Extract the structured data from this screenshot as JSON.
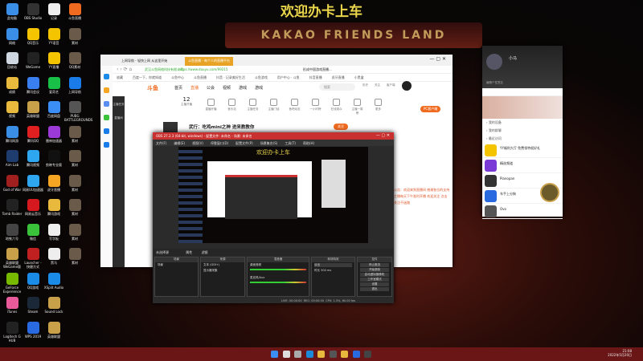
{
  "overlay_title": "欢迎办卡上车",
  "sign_text": "KAKAO FRIENDS LAND",
  "desktop": {
    "icons": [
      [
        "此电脑",
        "#3a8ee6"
      ],
      [
        "网络",
        "#3a8ee6"
      ],
      [
        "回收站",
        "#cfd8e0"
      ],
      [
        "成绩",
        "#e8b93c"
      ],
      [
        "视频",
        "#e8b93c"
      ],
      [
        "腾讯网游",
        "#3a8ee6"
      ],
      [
        "Aim Lab",
        "#1e3c6e"
      ],
      [
        "God of War",
        "#a02020"
      ],
      [
        "Tomb Raider",
        "#222"
      ],
      [
        "地铁六号",
        "#444"
      ],
      [
        "英雄联盟WeGame版",
        "#c9a04a"
      ],
      [
        "GeForce Experience",
        "#76b900"
      ],
      [
        "iTunes",
        "#e85a9a"
      ],
      [
        "Logitech G HUB",
        "#222"
      ],
      [
        "OBS Studio",
        "#333"
      ],
      [
        "QQ音乐",
        "#f5c400"
      ],
      [
        "WeGame",
        "#222"
      ],
      [
        "腾讯会议",
        "#3a7ff0"
      ],
      [
        "英雄联盟",
        "#c9a04a"
      ],
      [
        "腾讯QQ",
        "#e02020"
      ],
      [
        "腾讯视频",
        "#2fa6f0"
      ],
      [
        "网易UU加速器",
        "#2fa6f0"
      ],
      [
        "网易云音乐",
        "#d6191e"
      ],
      [
        "微信",
        "#3ac33a"
      ],
      [
        "Launcher - 快捷方式",
        "#c02020"
      ],
      [
        "QQ游戏",
        "#1a8ce8"
      ],
      [
        "Steam",
        "#1b2838"
      ],
      [
        "WPS 2019",
        "#2a6ae0"
      ],
      [
        "记录",
        "#eee"
      ],
      [
        "YY语音",
        "#f5c400"
      ],
      [
        "YY直播",
        "#f5c400"
      ],
      [
        "爱奇艺",
        "#18c047"
      ],
      [
        "百度网盘",
        "#3a8ef6"
      ],
      [
        "雷神加速器",
        "#9b3ad6"
      ],
      [
        "剪映专业版",
        "#111"
      ],
      [
        "虎牙直播",
        "#f5a623"
      ],
      [
        "腾讯游戏",
        "#e8b93c"
      ],
      [
        "写字板",
        "#eee"
      ],
      [
        "黑马",
        "#eee"
      ],
      [
        "XSplit Audio",
        "#1a8ce8"
      ],
      [
        "Sound Lock",
        "#c9a04a"
      ],
      [
        "英雄联盟",
        "#c9a04a"
      ],
      [
        "斗鱼直播",
        "#f06a20"
      ],
      [
        "素材",
        "#6a5a4a"
      ],
      [
        "QQ素材",
        "#6a5a4a"
      ],
      [
        "上网导航",
        "#1a7ce8"
      ],
      [
        "PUBG BATTLEGROUNDS",
        "#555"
      ],
      [
        "素材",
        "#6a5a4a"
      ],
      [
        "素材",
        "#6a5a4a"
      ],
      [
        "素材",
        "#6a5a4a"
      ],
      [
        "素材",
        "#6a5a4a"
      ],
      [
        "素材",
        "#6a5a4a"
      ],
      [
        "素材",
        "#6a5a4a"
      ]
    ]
  },
  "browser": {
    "tabs": [
      "上网导航 - 轻快上网 从这里开始",
      "斗鱼直播 - 每个人的直播平台"
    ],
    "url": "https://www.douyu.com/99215",
    "site_badge": "武汉斗鱼网络科技有限公司",
    "search_hint": "形成中国游戏直播...",
    "bookmarks": [
      "收藏",
      "百度一下，你就知道",
      "斗鱼中心",
      "斗鱼直播",
      "抖音 · 记录美好生活",
      "斗鱼游戏",
      "用户中心 · 斗鱼",
      "抖音直播",
      "虎牙直播",
      "小黑盒"
    ],
    "logo": "斗鱼",
    "nav": [
      "首页",
      "直播",
      "公会",
      "视频",
      "游戏",
      "游戏"
    ],
    "search_placeholder": "搜索",
    "header_icons": [
      "历史",
      "关注",
      "客户端"
    ],
    "follow_count": "12",
    "follow_label": "主播开播",
    "icon_row": [
      "直播开播",
      "音乐站",
      "主播任务",
      "主播门徒",
      "鱼吧动态",
      "一小时榜",
      "在线观众",
      "主播一周榜",
      "更多"
    ],
    "pc_button": "PC客户端",
    "stream_title": "武行：吃鸡mini之神 进来教教你",
    "follow_btn": "关注",
    "side_links": [
      "主播任务",
      "直播间"
    ],
    "notice": "公告：欢迎来到直播间 感谢各位的支持 主播每天下午准时开播 欢迎关注 点击关注不迷路"
  },
  "obs": {
    "title": "OBS 27.2.3 (64-bit, windows) - 配置文件: 未命名 - 场景: 未命名",
    "menu": [
      "文件(F)",
      "编辑(E)",
      "视图(V)",
      "停靠窗口(D)",
      "配置文件(P)",
      "场景集合(S)",
      "工具(T)",
      "帮助(H)"
    ],
    "no_source": "未选择源",
    "props": "属性",
    "filters": "滤镜",
    "docks": {
      "scenes": "场景",
      "sources": "来源",
      "mixer": "混音器",
      "transitions": "转场特效",
      "controls": "控件"
    },
    "scene_item": "场景",
    "sources": [
      "文本 (GDI+)",
      "显示器采集"
    ],
    "mixer": [
      {
        "name": "桌面音频",
        "db": "0.0 dB"
      },
      {
        "name": "麦克风/Aux",
        "db": "0.0 dB"
      }
    ],
    "transition": "淡出",
    "duration_label": "时长",
    "duration": "300 ms",
    "controls": [
      "停止推流",
      "开始录制",
      "启动虚拟摄像机",
      "工作室模式",
      "设置",
      "退出"
    ],
    "status": {
      "live": "LIVE: 00:00:00",
      "rec": "REC: 00:00:00",
      "cpu": "CPU: 1.3%, 60.00 fps"
    }
  },
  "qq": {
    "name": "小马",
    "signature": "编辑个性签名",
    "sections": [
      "我的设备",
      "我的群聊",
      "最近访问"
    ],
    "items": [
      [
        "YY福利大厅 免费领特权好礼",
        "#f5c400"
      ],
      [
        "精选频道",
        "#7a3ad6"
      ],
      [
        "Pianopan",
        "#333"
      ],
      [
        "车手上分狗",
        "#2a6ae0"
      ],
      [
        "Ovo",
        "#555"
      ]
    ]
  },
  "taskbar": {
    "time": "21:08",
    "date": "2022年5月20日"
  }
}
